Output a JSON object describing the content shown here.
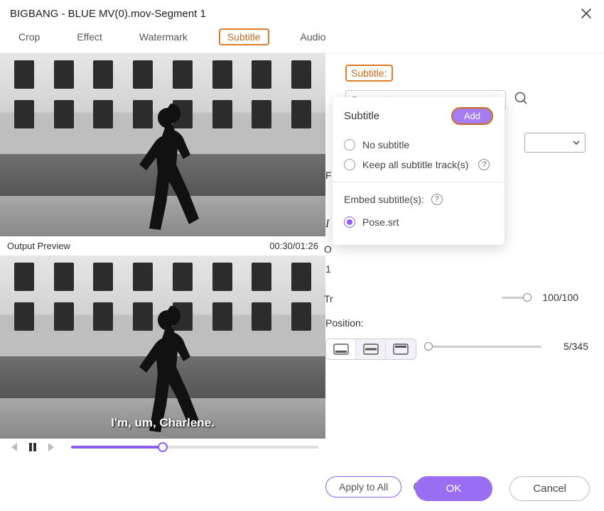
{
  "window": {
    "title": "BIGBANG - BLUE MV(0).mov-Segment 1"
  },
  "tabs": {
    "crop": "Crop",
    "effect": "Effect",
    "watermark": "Watermark",
    "subtitle": "Subtitle",
    "audio": "Audio"
  },
  "preview": {
    "label": "Output Preview",
    "time": "00:30/01:26",
    "subtitle_line": "I'm, um, Charlene."
  },
  "right": {
    "subtitle_label": "Subtitle:",
    "subtitle_dropdown_value": "Pose.srt",
    "transparency_value": "100/100",
    "position_label": "Position:",
    "position_value": "5/345",
    "apply_all": "Apply to All",
    "obscured_F": "F",
    "obscured_I": "I",
    "obscured_O": "O",
    "obscured_1": "1",
    "obscured_Tr": "Tr"
  },
  "popup": {
    "title": "Subtitle",
    "add": "Add",
    "no_subtitle": "No subtitle",
    "keep_all": "Keep all subtitle track(s)",
    "embed_label": "Embed subtitle(s):",
    "selected_file": "Pose.srt"
  },
  "footer": {
    "ok": "OK",
    "cancel": "Cancel"
  }
}
